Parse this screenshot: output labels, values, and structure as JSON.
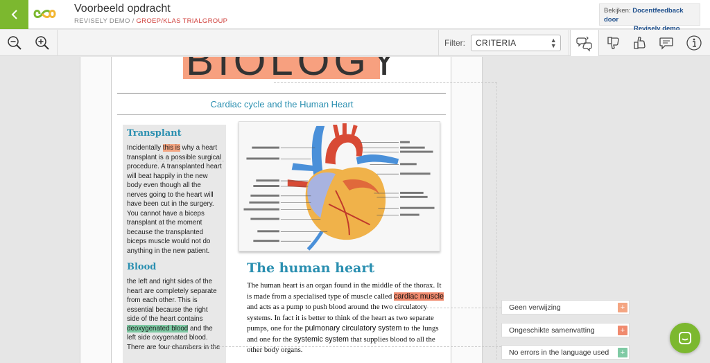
{
  "header": {
    "title": "Voorbeeld opdracht",
    "crumb_demo": "REVISELY DEMO",
    "crumb_sep": " / ",
    "crumb_group": "GROEP/KLAS TRIALGROUP",
    "view_label": "Bekijken:",
    "view_link_1": "Docentfeedback door",
    "view_link_2": "Revisely demo"
  },
  "toolbar": {
    "filter_label": "Filter:",
    "filter_value": "CRITERIA",
    "icons": [
      "zoom-out-icon",
      "zoom-in-icon",
      "criteria-chat-icon",
      "thumbs-down-icon",
      "thumbs-up-icon",
      "comment-icon",
      "info-icon"
    ]
  },
  "document": {
    "banner": "BIOLOGY",
    "subtitle": "Cardiac cycle and the Human Heart",
    "sidebar": {
      "heading1": "Transplant",
      "p1_a": "Incidentally ",
      "p1_hl": "this is",
      "p1_b": " why a heart transplant is a possible surgical procedure.  A transplanted heart will beat happily in the new body even though all the nerves going to the heart will have been cut in the surgery. You cannot have a biceps transplant at the moment because the transplanted biceps muscle would not do anything in the new patient.",
      "heading2": "Blood",
      "p2_a": "the left and right sides of the heart are completely separate from each other.  This is essential because the right side of the heart contains ",
      "p2_hl": "deoxygenated blood",
      "p2_b": " and the left side ",
      "p2_c": "oxygenated blood",
      "p2_d": ". There are four chambers in the"
    },
    "article_title": "The human heart",
    "article": {
      "a": "The human heart is an organ found in the middle of the thorax.    It is made from a specialised type of muscle called ",
      "hl": "cardiac muscle",
      "b": " and acts as a pump to push blood around the two circulatory systems.    In fact it is better to think of the heart as two separate pumps, one for the ",
      "c": "pulmonary circulatory system",
      "d": " to the lungs and one for the ",
      "e": "systemic system",
      "f": " that supplies blood to all the other body organs."
    }
  },
  "comments": [
    {
      "label": "Geen verwijzing",
      "color": "#f4a582"
    },
    {
      "label": "Ongeschikte samenvatting",
      "color": "#f08a6e"
    },
    {
      "label": "No errors in the language used",
      "color": "#7fcaa4"
    }
  ],
  "colors": {
    "brand_green": "#7cb82f",
    "accent_blue": "#2a8fb0",
    "crumb_red": "#d0413d"
  }
}
